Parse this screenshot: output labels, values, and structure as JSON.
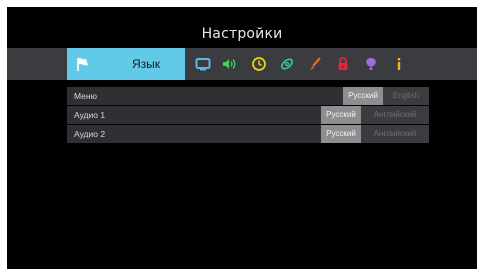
{
  "header": {
    "title": "Настройки"
  },
  "tabs": {
    "active_label": "Язык",
    "icons": [
      "flag-icon",
      "monitor-icon",
      "speaker-icon",
      "clock-icon",
      "network-icon",
      "brush-icon",
      "lock-icon",
      "balloon-icon",
      "info-icon"
    ]
  },
  "settings": {
    "rows": [
      {
        "label": "Меню",
        "options": [
          "Русский",
          "English"
        ],
        "selected": "Русский"
      },
      {
        "label": "Аудио 1",
        "options": [
          "Русский",
          "Английский"
        ],
        "selected": "Русский"
      },
      {
        "label": "Аудио 2",
        "options": [
          "Русский",
          "Английский"
        ],
        "selected": "Русский"
      }
    ]
  },
  "colors": {
    "accent": "#62c9e8",
    "background": "#000000",
    "bar": "#3a3c40"
  }
}
